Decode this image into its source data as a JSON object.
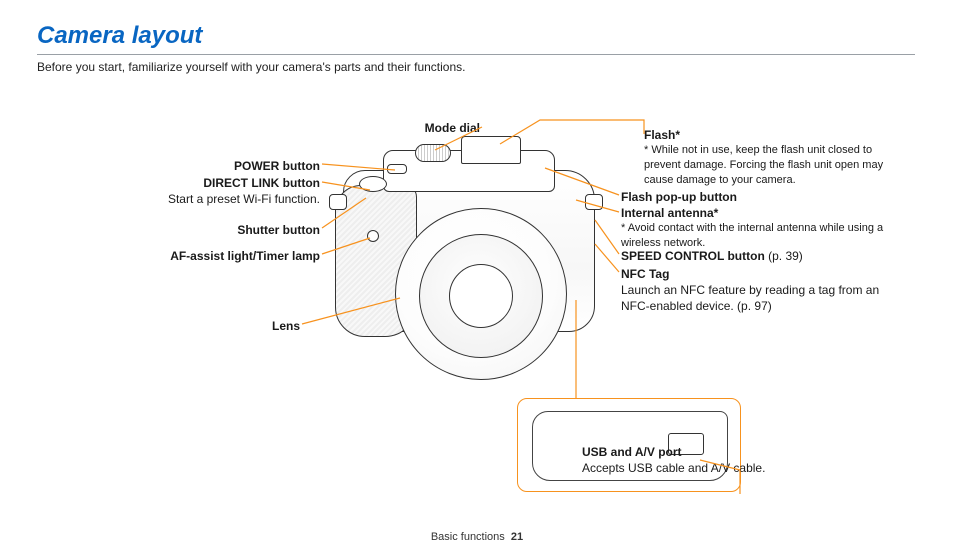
{
  "title": "Camera layout",
  "intro": "Before you start, familiarize yourself with your camera's parts and their functions.",
  "labels": {
    "mode_dial": "Mode dial",
    "power": "POWER button",
    "direct_link": "DIRECT LINK button",
    "direct_link_desc": "Start a preset Wi-Fi function.",
    "shutter": "Shutter button",
    "af_lamp": "AF-assist light/Timer lamp",
    "lens": "Lens",
    "flash": "Flash*",
    "flash_desc": "* While not in use, keep the flash unit closed to prevent damage. Forcing the flash unit open may cause damage to your camera.",
    "flash_popup": "Flash pop-up button",
    "antenna": "Internal antenna*",
    "antenna_desc": "* Avoid contact with the internal antenna while using a wireless network.",
    "speed": "SPEED CONTROL button",
    "speed_ref": " (p. 39)",
    "nfc": "NFC Tag",
    "nfc_desc": "Launch an NFC feature by reading a tag from an NFC-enabled device. (p. 97)",
    "usb": "USB and A/V port",
    "usb_desc": "Accepts USB cable and A/V cable."
  },
  "footer_section": "Basic functions",
  "footer_page": "21"
}
